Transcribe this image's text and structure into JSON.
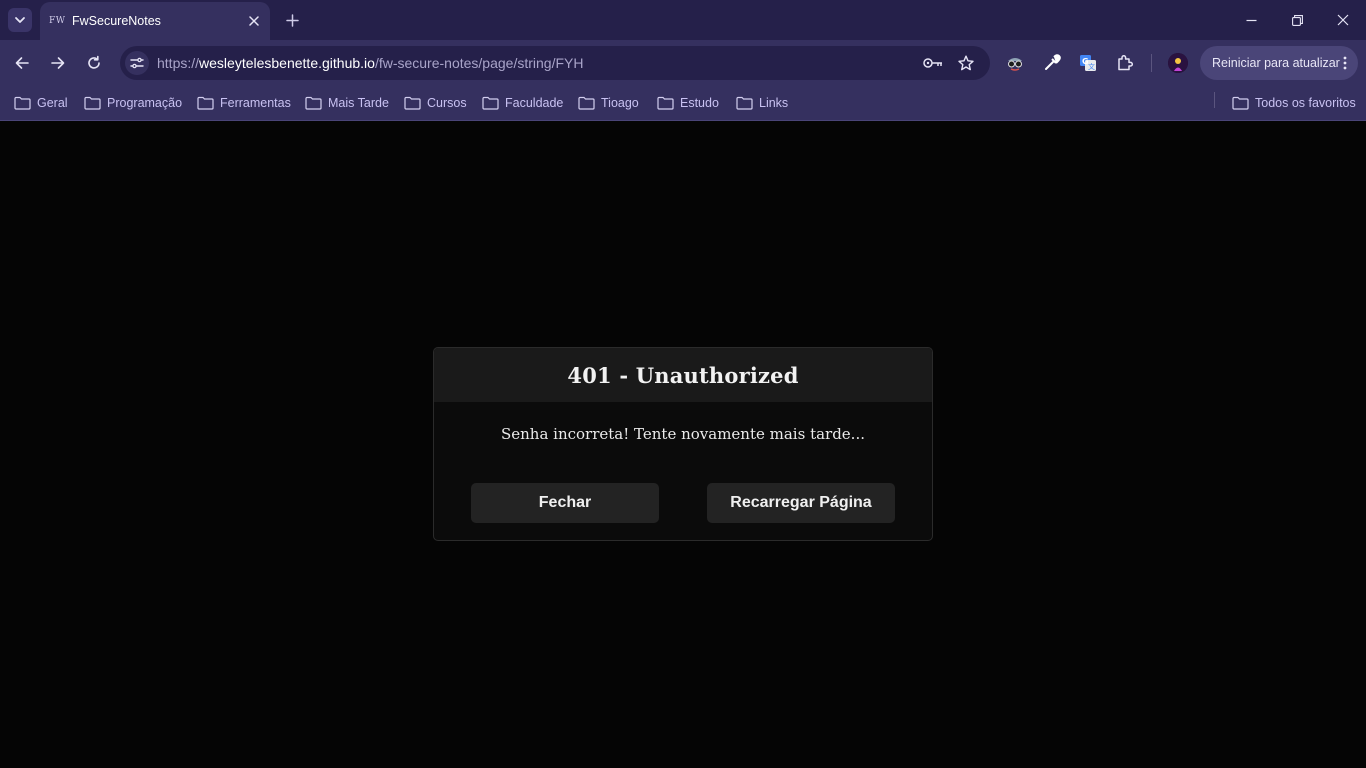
{
  "browser": {
    "tab": {
      "favicon_text": "FW",
      "title": "FwSecureNotes"
    },
    "address": {
      "scheme": "https://",
      "host": "wesleytelesbenette.github.io",
      "path": "/fw-secure-notes/page/string/FYH"
    },
    "restart_label": "Reiniciar para atualizar",
    "bookmarks": [
      "Geral",
      "Programação",
      "Ferramentas",
      "Mais Tarde",
      "Cursos",
      "Faculdade",
      "Tioago",
      "Estudo",
      "Links"
    ],
    "all_bookmarks_label": "Todos os favoritos"
  },
  "dialog": {
    "title": "401 - Unauthorized",
    "message": "Senha incorreta! Tente novamente mais tarde...",
    "close_label": "Fechar",
    "reload_label": "Recarregar Página"
  },
  "colors": {
    "tabstrip": "#25204a",
    "toolbar": "#35305f",
    "page_background": "#050505",
    "dialog_header": "#1a1a1a",
    "dialog_button": "#232323"
  },
  "icons": [
    "tab-search-icon",
    "close-icon",
    "plus-icon",
    "minimize-icon",
    "restore-icon",
    "back-icon",
    "forward-icon",
    "reload-icon",
    "site-info-icon",
    "key-icon",
    "star-icon",
    "spy-extension-icon",
    "eyedropper-icon",
    "translate-icon",
    "puzzle-icon",
    "avatar",
    "kebab-menu-icon",
    "folder-icon"
  ]
}
